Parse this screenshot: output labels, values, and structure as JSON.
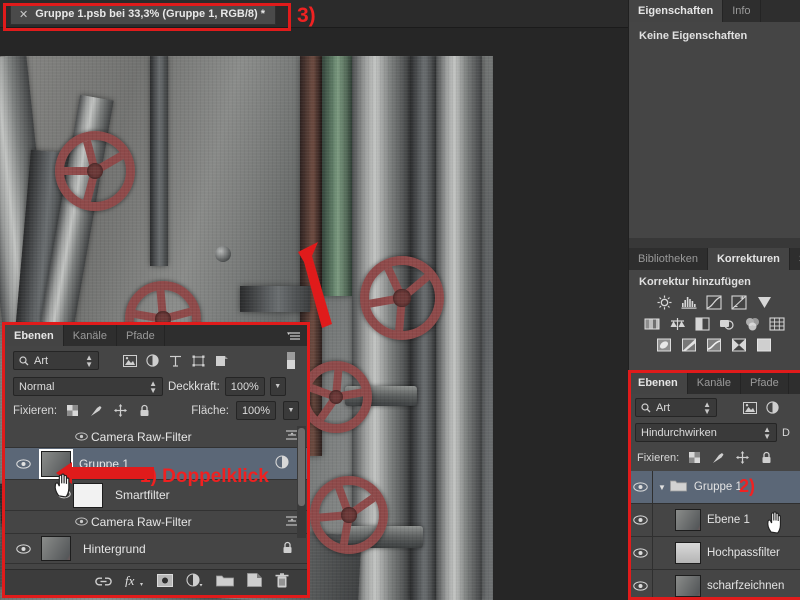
{
  "app": "Adobe Photoshop",
  "document_tab": {
    "close_icon": "close-icon",
    "title": "Gruppe 1.psb bei 33,3% (Gruppe 1, RGB/8) *"
  },
  "annotations": {
    "step1": "1) Doppelklick",
    "step2": "2)",
    "step3": "3)",
    "highlight_color": "#e01b1b",
    "text_color": "#f02020"
  },
  "properties_panel": {
    "tabs": [
      {
        "label": "Eigenschaften",
        "active": true
      },
      {
        "label": "Info",
        "active": false
      }
    ],
    "empty_text": "Keine Eigenschaften"
  },
  "adjustments_panel": {
    "tabs": [
      {
        "label": "Bibliotheken",
        "active": false
      },
      {
        "label": "Korrekturen",
        "active": true
      },
      {
        "label": "Sti",
        "active": false
      }
    ],
    "heading": "Korrektur hinzufügen",
    "icon_rows": [
      [
        "brightness-contrast-icon",
        "levels-icon",
        "curves-icon",
        "exposure-icon",
        "vibrance-icon"
      ],
      [
        "hue-saturation-icon",
        "color-balance-icon",
        "black-white-icon",
        "photo-filter-icon",
        "channel-mixer-icon",
        "color-lookup-icon"
      ],
      [
        "invert-icon",
        "posterize-icon",
        "threshold-icon",
        "gradient-map-icon",
        "selective-color-icon"
      ]
    ]
  },
  "dock_layers_panel": {
    "tabs": [
      {
        "label": "Ebenen",
        "active": true
      },
      {
        "label": "Kanäle",
        "active": false
      },
      {
        "label": "Pfade",
        "active": false
      }
    ],
    "filter_label": "Art",
    "filter_icons": [
      "pixel-layer-filter-icon",
      "adjustment-layer-filter-icon"
    ],
    "blend_mode": "Hindurchwirken",
    "opacity_label_truncated": "D",
    "lock_label": "Fixieren:",
    "lock_icons": [
      "lock-transparency-icon",
      "lock-image-icon",
      "lock-position-icon",
      "lock-all-icon"
    ],
    "layers": [
      {
        "name": "Gruppe 1",
        "type": "group",
        "selected": true,
        "expanded": true,
        "visible": true,
        "thumb": "folder"
      },
      {
        "name": "Ebene 1",
        "type": "layer",
        "selected": false,
        "visible": true,
        "thumb": "photo"
      },
      {
        "name": "Hochpassfilter",
        "type": "layer",
        "selected": false,
        "visible": true,
        "thumb": "gray"
      },
      {
        "name": "scharfzeichnen",
        "type": "layer",
        "selected": false,
        "visible": true,
        "thumb": "photo"
      }
    ]
  },
  "floating_layers_panel": {
    "tabs": [
      {
        "label": "Ebenen",
        "active": true
      },
      {
        "label": "Kanäle",
        "active": false
      },
      {
        "label": "Pfade",
        "active": false
      }
    ],
    "menu_icon": "panel-menu-icon",
    "filter_label": "Art",
    "filter_icons": [
      "pixel-layer-filter-icon",
      "adjustment-layer-filter-icon",
      "type-layer-filter-icon",
      "shape-layer-filter-icon",
      "smart-object-filter-icon"
    ],
    "filter_toggle": "filter-toggle-icon",
    "blend_mode": "Normal",
    "opacity_label": "Deckkraft:",
    "opacity_value": "100%",
    "lock_label": "Fixieren:",
    "lock_icons": [
      "lock-transparency-icon",
      "lock-image-icon",
      "lock-position-icon",
      "lock-all-icon"
    ],
    "fill_label": "Fläche:",
    "fill_value": "100%",
    "rows": [
      {
        "name": "Camera Raw-Filter",
        "kind": "smartfilter-effect",
        "visible": true,
        "indent": 2
      },
      {
        "name": "Gruppe 1",
        "kind": "smart-object",
        "selected": true,
        "visible": true,
        "indent": 0
      },
      {
        "name": "Smartfilter",
        "kind": "smartfilter-header",
        "visible": true,
        "indent": 1
      },
      {
        "name": "Camera Raw-Filter",
        "kind": "smartfilter-effect",
        "visible": true,
        "indent": 2
      },
      {
        "name": "Hintergrund",
        "kind": "background",
        "visible": true,
        "locked": true,
        "indent": 0
      }
    ],
    "bottom_icons": [
      "link-layers-icon",
      "layer-style-fx-icon",
      "add-mask-icon",
      "new-adjustment-icon",
      "new-group-icon",
      "new-layer-icon",
      "delete-layer-icon"
    ]
  },
  "canvas": {
    "image_description": "industrial pipes with red valve wheels",
    "zoom": "33,3%"
  }
}
